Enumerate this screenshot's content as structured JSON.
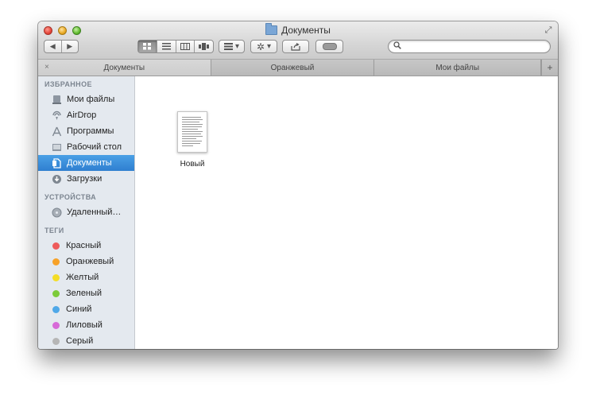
{
  "window": {
    "title": "Документы"
  },
  "toolbar": {
    "back_glyph": "◀",
    "forward_glyph": "▶",
    "view_icons": [
      "icon-view-icon",
      "list-view-icon",
      "column-view-icon",
      "coverflow-view-icon"
    ],
    "arrange_glyph": "▾",
    "action_glyph": "▾"
  },
  "search": {
    "value": "",
    "placeholder": ""
  },
  "tabs": [
    {
      "label": "Документы"
    },
    {
      "label": "Оранжевый"
    },
    {
      "label": "Мои файлы"
    }
  ],
  "sidebar": {
    "favorites_title": "ИЗБРАННОЕ",
    "favorites": [
      {
        "label": "Мои файлы",
        "icon": "all-files-icon"
      },
      {
        "label": "AirDrop",
        "icon": "airdrop-icon"
      },
      {
        "label": "Программы",
        "icon": "applications-icon"
      },
      {
        "label": "Рабочий стол",
        "icon": "desktop-icon"
      },
      {
        "label": "Документы",
        "icon": "documents-icon"
      },
      {
        "label": "Загрузки",
        "icon": "downloads-icon"
      }
    ],
    "devices_title": "УСТРОЙСТВА",
    "devices": [
      {
        "label": "Удаленный…",
        "icon": "remote-disc-icon"
      }
    ],
    "tags_title": "ТЕГИ",
    "tags": [
      {
        "label": "Красный",
        "color": "#ee5b5b"
      },
      {
        "label": "Оранжевый",
        "color": "#f7a229"
      },
      {
        "label": "Желтый",
        "color": "#f4dd27"
      },
      {
        "label": "Зеленый",
        "color": "#7ccb3a"
      },
      {
        "label": "Синий",
        "color": "#4fa8e8"
      },
      {
        "label": "Лиловый",
        "color": "#d76ad8"
      },
      {
        "label": "Серый",
        "color": "#b6b6b6"
      }
    ]
  },
  "files": [
    {
      "name": "Новый",
      "icon": "text-document-icon"
    }
  ],
  "colors": {
    "selection": "#3a8ad9",
    "sidebar_bg": "#e4e9ef"
  }
}
